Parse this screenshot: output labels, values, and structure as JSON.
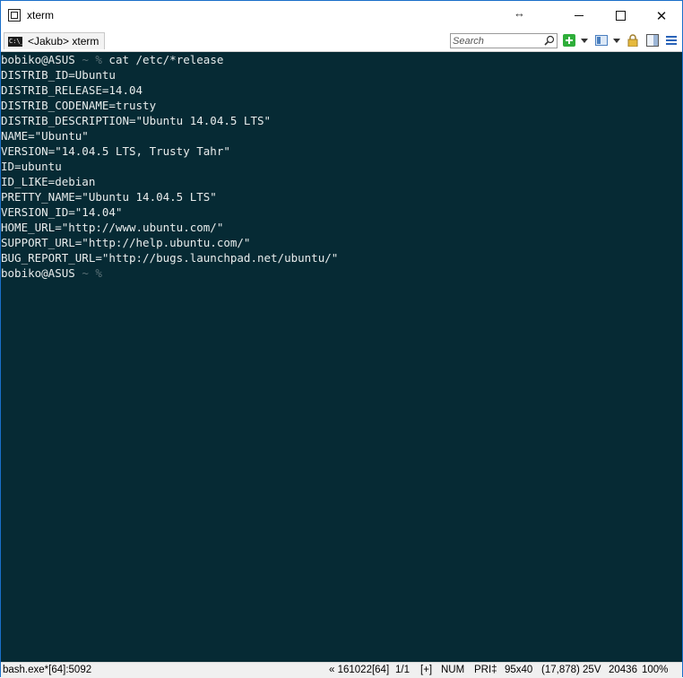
{
  "window": {
    "title": "xterm",
    "resize_glyph": "↔",
    "close_glyph": "✕"
  },
  "tab": {
    "icon_text": "C:\\_",
    "label": "<Jakub> xterm"
  },
  "search": {
    "placeholder": "Search",
    "value": ""
  },
  "toolbar_icons": [
    "add-icon",
    "dropdown-arrow-icon",
    "view-icon",
    "dropdown-arrow-icon",
    "lock-icon",
    "pane-icon",
    "hamburger-menu-icon"
  ],
  "terminal": {
    "prompt_user": "bobiko@ASUS",
    "prompt_sep": " ~ ",
    "prompt_sym": "%",
    "command": " cat /etc/*release",
    "output": [
      "DISTRIB_ID=Ubuntu",
      "DISTRIB_RELEASE=14.04",
      "DISTRIB_CODENAME=trusty",
      "DISTRIB_DESCRIPTION=\"Ubuntu 14.04.5 LTS\"",
      "NAME=\"Ubuntu\"",
      "VERSION=\"14.04.5 LTS, Trusty Tahr\"",
      "ID=ubuntu",
      "ID_LIKE=debian",
      "PRETTY_NAME=\"Ubuntu 14.04.5 LTS\"",
      "VERSION_ID=\"14.04\"",
      "HOME_URL=\"http://www.ubuntu.com/\"",
      "SUPPORT_URL=\"http://help.ubuntu.com/\"",
      "BUG_REPORT_URL=\"http://bugs.launchpad.net/ubuntu/\""
    ]
  },
  "colors": {
    "terminal_bg": "#062a34",
    "terminal_fg": "#e8ecec",
    "prompt_dim": "#5b7177",
    "window_border": "#1a6fc9"
  },
  "statusbar": {
    "process": "bash.exe*[64]:5092",
    "build": "« 161022[64]",
    "page": "1/1",
    "plus": "[+]",
    "num": "NUM",
    "pri": "PRI‡",
    "size": "95x40",
    "coords": "(17,878) 25V",
    "mem": "20436",
    "zoom": "100%"
  }
}
